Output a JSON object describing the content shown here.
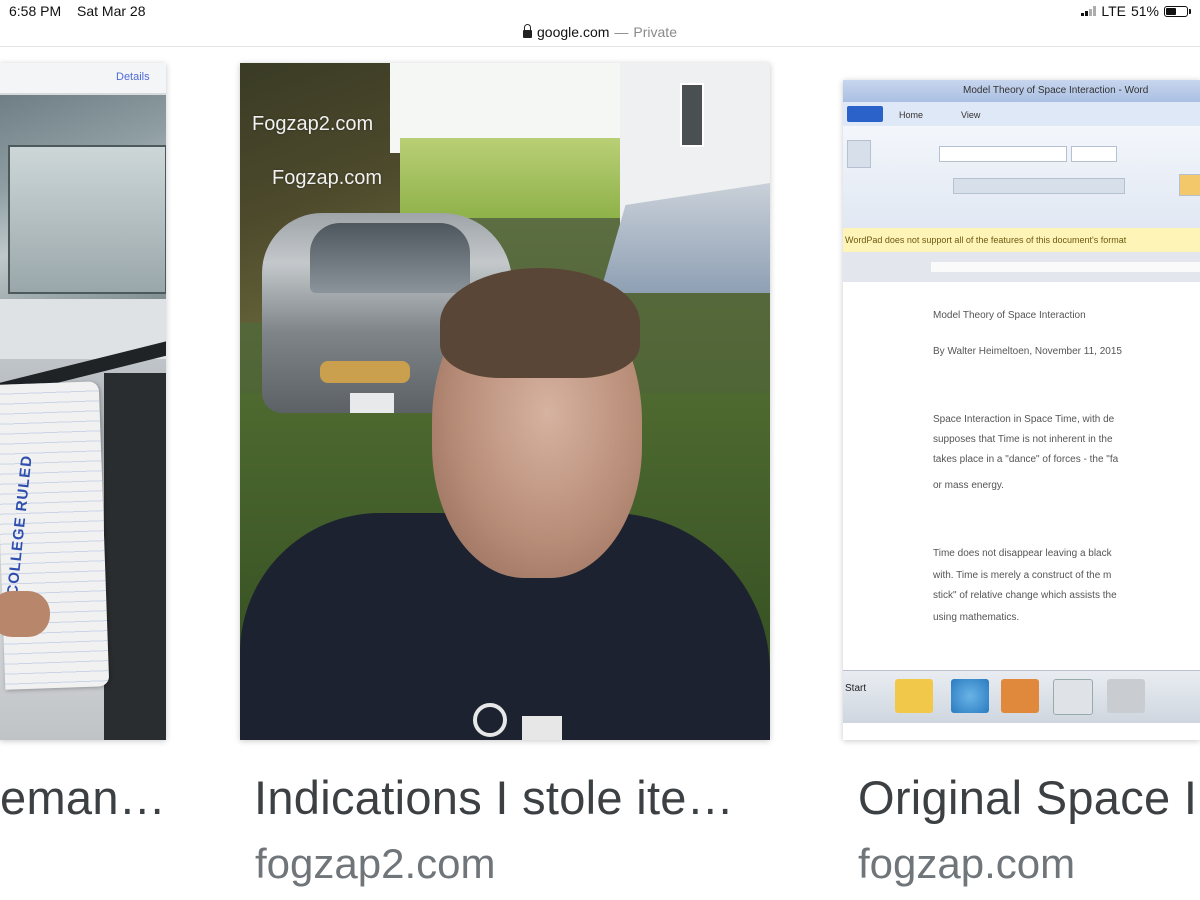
{
  "status_bar": {
    "time": "6:58 PM",
    "date": "Sat Mar 28",
    "network": "LTE",
    "battery": "51%",
    "battery_level": 0.51
  },
  "address_bar": {
    "domain": "google.com",
    "separator": "—",
    "mode": "Private"
  },
  "results": [
    {
      "title": "eman…",
      "source": "",
      "image": {
        "top_label": "Details",
        "ruled_text": "COLLEGE RULED"
      }
    },
    {
      "title": "Indications I stole ite…",
      "source": "fogzap2.com",
      "image": {
        "watermark_1": "Fogzap2.com",
        "watermark_2": "Fogzap.com"
      }
    },
    {
      "title": "Original Space I",
      "source": "fogzap.com",
      "image": {
        "window_title": "Model Theory of Space Interaction - Word",
        "tab_home": "Home",
        "tab_view": "View",
        "notice": "WordPad does not support all of the features of this document's format",
        "doc_heading": "Model Theory of Space Interaction",
        "doc_byline": "By Walter Heimeltoen, November 11, 2015",
        "para_1_line_1": "Space Interaction in Space Time, with de",
        "para_1_line_2": "supposes that Time is not inherent in the",
        "para_1_line_3": "takes place in a \"dance\" of forces - the \"fa",
        "para_1_line_4": "or mass energy.",
        "para_2_line_1": "Time does not disappear leaving a black",
        "para_2_line_2": "with.  Time is merely a construct of the m",
        "para_2_line_3": "stick\" of relative change which assists the",
        "para_2_line_4": "using mathematics.",
        "start_label": "Start"
      }
    }
  ]
}
